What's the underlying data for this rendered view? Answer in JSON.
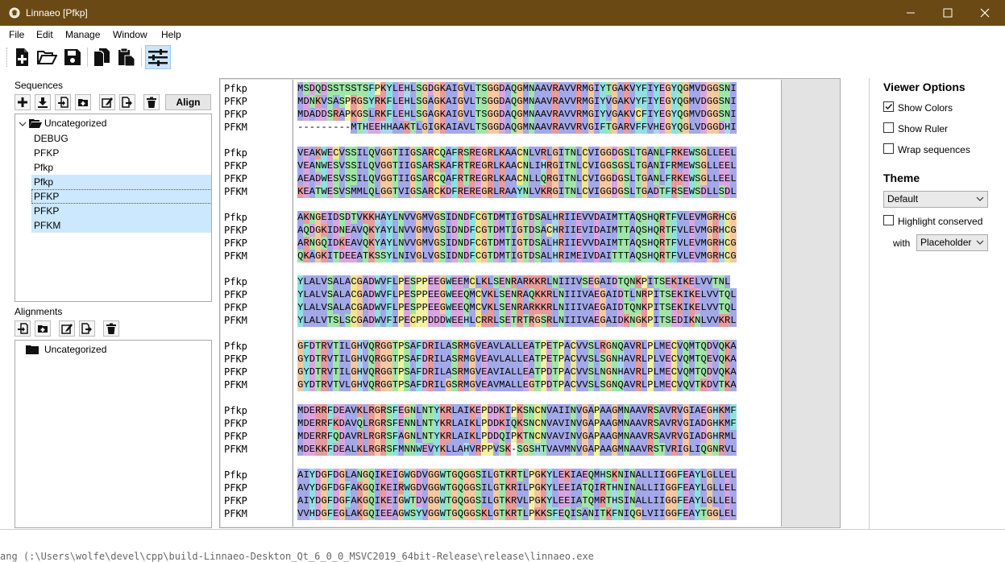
{
  "window": {
    "title": "Linnaeo [Pfkp]"
  },
  "menu": [
    "File",
    "Edit",
    "Manage",
    "Window",
    "Help"
  ],
  "toolbar": {
    "icons": [
      "new-file-icon",
      "open-folder-icon",
      "save-icon",
      "copy-icon",
      "paste-icon",
      "options-sliders-icon"
    ]
  },
  "sequences": {
    "label": "Sequences",
    "align_label": "Align",
    "folder": "Uncategorized",
    "items": [
      "DEBUG",
      "PFKP",
      "Pfkp",
      "Pfkp",
      "PFKP",
      "PFKP",
      "PFKM"
    ]
  },
  "alignments": {
    "label": "Alignments",
    "folder": "Uncategorized"
  },
  "alignment": {
    "names": [
      "Pfkp",
      "PFKP",
      "PFKP",
      "PFKM"
    ],
    "blocks": [
      [
        "MSDQDSSTSSTSFPKYLEHLSGDGKAIGVLTSGGDAQGMNAAVRAVVRMGIYTGAKVYFIYEGYQGMVDGGSNI",
        "MDNKVSASPRGSYRKFLEHLSGAGKAIGVLTSGGDAQGMNAAVRAVVRMGIYVGAKVYFIYEGYQGMVDGGSNI",
        "MDADDSRAPKGSLRKFLEHLSGAGKAIGVLTSGGDAQGMNAAVRAVVRMGIYVGAKVCFIYEGYQGMVDGGSNI",
        "---------MTHEEHHAAKTLGIGKAIAVLTSGGDAQGMNAAVRAVVRVGIFTGARVFFVHEGYQGLVDGGDHI"
      ],
      [
        "VEAKWECVSSILQVGGTIIGSARCQAFRSREGRLKAACNLVRLGITNLCVIGGDGSLTGANLFRKEWSGLLEEL",
        "VEANWESVSSILQVGGTIIGSARSKAFRTREGRLKAACNLIHRGITNLCVIGGSGSLTGANIFRMEWSGLLEEL",
        "AEADWESVSSILQVGGTIIGSARCQAFRTREGRLKAACNLLQRGITNLCVIGGDGSLTGANLFRKEWSGLLEEL",
        "KEATWESVSMMLQLGGTVIGSARCKDFREREGRLRAAYNLVKRGITNLCVIGGDGSLTGADTFRSEWSDLLSDL"
      ],
      [
        "AKNGEIDSDTVKKHAYLNVVGMVGSIDNDFCGTDMTIGTDSALHRIIEVVDAIMTTAQSHQRTFVLEVMGRHCG",
        "AQDGKIDNEAVQKYAYLNVVGMVGSIDNDFCGTDMTIGTDSACHRIIEVIDAIMTTAQSHQRTFVLEVMGRHCG",
        "ARNGQIDKEAVQKYAYLNVVGMVGSIDNDFCGTDMTIGTDSALHRIIEVVDAIMTTAQSHQRTFVLEVMGRHCG",
        "QKAGKITDEEATKSSYLNIVGLVGSIDNDFCGTDMTIGTDSALHRIMEIVDAITTTAQSHQRTFVLEVMGRHCG"
      ],
      [
        "YLALVSALACGADWVFLPESPPEEGWEEMCLKLSENRARKKRLNIIIVSEGAIDTQNKPITSEKIKELVVTNL",
        "YLALVSALACGADWVFLPESPPEEGWEEQMCVKLSENRAQKKRLNIIIVAEGAIDTLNRPITSEKIKELVVTQL",
        "YLALVSALACGADWVFLPESPPEEGWEEQMCVKLSENRARKKRLNIIIVAEGAIDTQNKPITSEKIKELVVTQL",
        "YLALVTSLSCGADWVFIPECPPDDDWEEHLCRRLSETRTRGSRLNIIIVAEGAIDKNGKPITSEDIKNLVVKRL"
      ],
      [
        "GFDTRVTILGHVQRGGTPSAFDRILASRMGVEAVLALLEATPETPACVVSLRGNQAVRLPLMECVQMTQDVQKA",
        "GYDTRVTILGHVQRGGTPSAFDRILASRMGVEAVLALLEATPETPACVVSLSGNHAVRLPLVECVQMTQEVQKA",
        "GYDTRVTILGHVQRGGTPSAFDRILASRMGVEAVIALLEATPDTPACVVSLNGNHAVRLPLMECVQMTQDVQKA",
        "GYDTRVTVLGHVQRGGTPSAFDRILGSRMGVEAVMALLEGTPDTPACVVSLSGNQAVRLPLMECVQVTKDVTKA"
      ],
      [
        "MDERRFDEAVKLRGRSFEGNLNTYKRLAIKEPDDKIPKSNCNVAIINVGAPAAGMNAAVRSAVRVGIAEGHKMF",
        "MDERRFKDAVQLRGRSFENNLNTYKRLAIKLPDDKIQKSNCNVAVINVGAPAAGMNAAVRSAVRVGIADGHKMF",
        "MDERRFQDAVRLRGRSFAGNLNTYKRLAIKLPDDQIPKTNCNVAVINVGAPAAGMNAAVRSAVRVGIADGHRML",
        "MDEKKFDEALKLRGRSFMNNWEVYKLLAHVRPPVSK-SGSHTVAVMNVGAPAAGMNAAVRSTVRIGLIQGNRVL"
      ],
      [
        "AIYDGFDGLANGQIKEIGWGDVGGWTGQGGSILGTKRTLPGKYLEKIAEQMHSKNINALLIIGGFEAYLGLLEL",
        "AVYDGFDGFAKGQIKEIRWGDVGGWTGQGGSILGTKRILPGKYLEEIATQIRTHNINALLIIGGFEAYLGLLEL",
        "AIYDGFDGFAKGQIKEIGWTDVGGWTGQGGSILGTKRVLPGKYLEEIATQMRTHSINALLIIGGFEAYLGLLEL",
        "VVHDGFEGLAKGQIEEAGWSYVGGWTGQGGSKLGTKRTLPKKSFEQISANITKFNIQGLVIIGGFEAYTGGLEL"
      ]
    ],
    "residue_colors": {
      "hydrophobic": "#a3a8e8",
      "positive": "#ea9a9a",
      "negative": "#d9a6e0",
      "polar": "#9fe6a8",
      "glycine": "#f5c8a0",
      "proline": "#f2f2a0",
      "aromatic": "#8fe0e0",
      "cysteine": "#f0e68c",
      "histidine": "#a8d8f0",
      "gap": "#ffffff"
    }
  },
  "viewer_options": {
    "title": "Viewer Options",
    "show_colors": {
      "label": "Show Colors",
      "checked": true
    },
    "show_ruler": {
      "label": "Show Ruler",
      "checked": false
    },
    "wrap_sequences": {
      "label": "Wrap sequences",
      "checked": false
    },
    "theme_title": "Theme",
    "theme_value": "Default",
    "highlight_conserved": {
      "label": "Highlight conserved",
      "checked": false
    },
    "with_label": "with",
    "with_value": "Placeholder"
  },
  "bottom_text": "ang (:\\Users\\wolfe\\devel\\cpp\\build-Linnaeo-Deskton_Qt_6_0_0_MSVC2019_64bit-Release\\release\\linnaeo.exe"
}
